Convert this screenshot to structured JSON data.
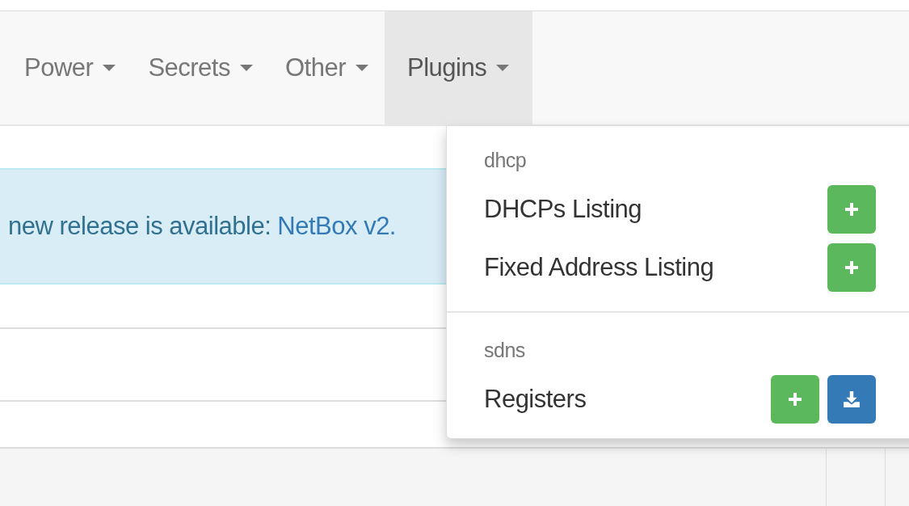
{
  "navbar": {
    "items": [
      {
        "label": "Power",
        "selected": false
      },
      {
        "label": "Secrets",
        "selected": false
      },
      {
        "label": "Other",
        "selected": false
      },
      {
        "label": "Plugins",
        "selected": true
      }
    ]
  },
  "alert": {
    "text": "new release is available: ",
    "link": "NetBox v2."
  },
  "dropdown": {
    "sections": [
      {
        "header": "dhcp",
        "items": [
          {
            "label": "DHCPs Listing",
            "buttons": [
              {
                "kind": "add"
              }
            ]
          },
          {
            "label": "Fixed Address Listing",
            "buttons": [
              {
                "kind": "add"
              }
            ]
          }
        ]
      },
      {
        "header": "sdns",
        "items": [
          {
            "label": "Registers",
            "buttons": [
              {
                "kind": "add"
              },
              {
                "kind": "import"
              }
            ]
          }
        ]
      }
    ]
  }
}
